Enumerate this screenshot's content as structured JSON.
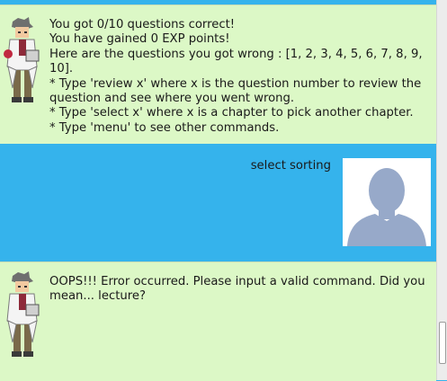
{
  "messages": {
    "bot_result": {
      "lines": [
        "You got 0/10 questions correct!",
        "You have gained 0 EXP points!",
        "Here are the questions you got wrong : [1, 2, 3, 4, 5, 6, 7, 8, 9,\n10].",
        "* Type 'review x' where x is the question number to review the\nquestion and see where you went wrong.",
        "* Type 'select x' where x is a chapter to pick another chapter.",
        "* Type 'menu' to see other commands."
      ],
      "avatar_icon": "professor-sprite-icon"
    },
    "user": {
      "text": "select sorting",
      "avatar_icon": "default-user-silhouette-icon"
    },
    "bot_error": {
      "text": "OOPS!!! Error occurred. Please input a valid command. Did you\nmean... lecture?",
      "avatar_icon": "professor-sprite-icon"
    }
  },
  "colors": {
    "bot_bubble": "#dcf8c6",
    "user_background": "#35b3ec",
    "silhouette": "#97a9c9"
  }
}
